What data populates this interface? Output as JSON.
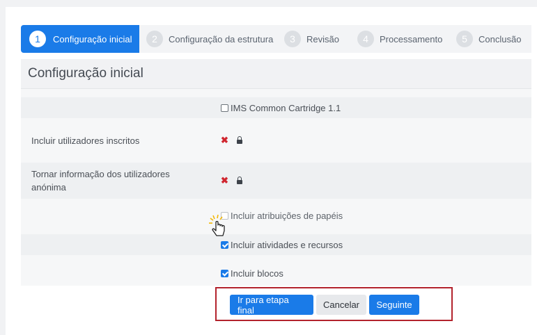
{
  "stepper": {
    "steps": [
      {
        "number": "1",
        "label": "Configuração inicial"
      },
      {
        "number": "2",
        "label": "Configuração da estrutura"
      },
      {
        "number": "3",
        "label": "Revisão"
      },
      {
        "number": "4",
        "label": "Processamento"
      },
      {
        "number": "5",
        "label": "Conclusão"
      }
    ],
    "active_step": 1
  },
  "section": {
    "title": "Configuração inicial",
    "ims_label": "IMS Common Cartridge 1.1",
    "ims_checked": false,
    "include_users": {
      "label": "Incluir utilizadores inscritos",
      "value_icon": "x-mark-icon",
      "locked": true
    },
    "anonymize_users": {
      "label": "Tornar informação dos utilizadores anónima",
      "value_icon": "x-mark-icon",
      "locked": true
    },
    "role_assignments": {
      "label": "Incluir atribuições de papéis",
      "checked": false,
      "disabled": true
    },
    "activities": {
      "label": "Incluir atividades e recursos",
      "checked": true
    },
    "blocks": {
      "label": "Incluir blocos",
      "checked": true
    }
  },
  "footer": {
    "final_step_label": "Ir para etapa final",
    "cancel_label": "Cancelar",
    "next_label": "Seguinte"
  },
  "colors": {
    "accent": "#1a7be8",
    "error_x": "#d0262f",
    "highlight_box": "#b3232d"
  },
  "cursor": "hand-pointer-icon"
}
